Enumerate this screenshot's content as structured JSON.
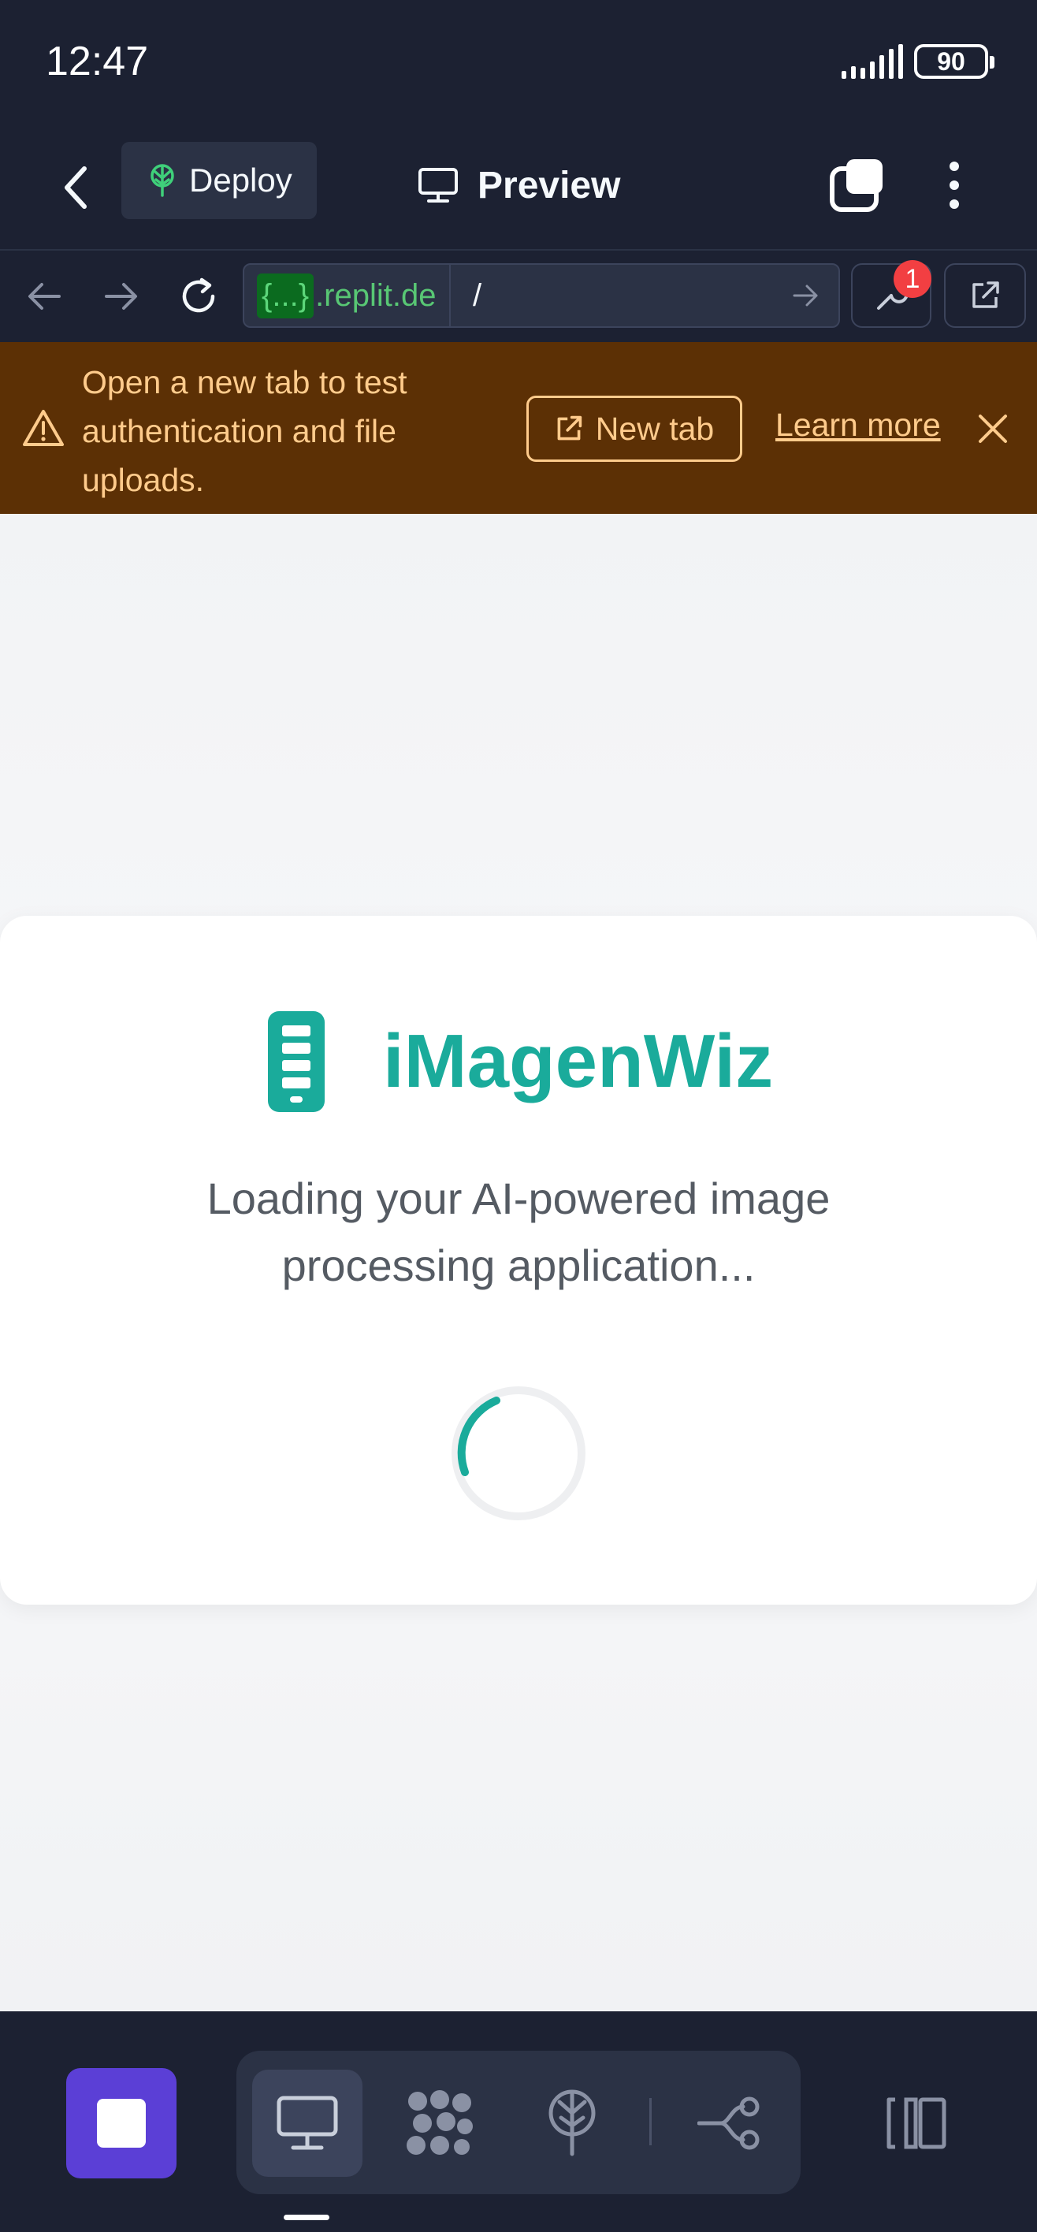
{
  "status_bar": {
    "time": "12:47",
    "battery": "90"
  },
  "header": {
    "deploy_label": "Deploy",
    "title": "Preview"
  },
  "url_bar": {
    "host_chip": "{...}",
    "host": ".replit.de",
    "path": "/",
    "devtools_badge": "1"
  },
  "banner": {
    "message": "Open a new tab to test authentication and file uploads.",
    "new_tab_label": "New tab",
    "learn_more_label": "Learn more"
  },
  "app": {
    "name": "iMagenWiz",
    "loading_text": "Loading your AI-powered image processing application..."
  },
  "bottom_bar": {
    "tabs": [
      "preview",
      "packages",
      "deployments",
      "git"
    ]
  },
  "colors": {
    "background": "#1c2132",
    "surface": "#2b3245",
    "banner_bg": "#5c3005",
    "banner_text": "#ffcb8c",
    "brand_teal": "#1aab9b",
    "stop_button": "#5b3fd6",
    "badge_red": "#f23f42"
  },
  "icons": {
    "back": "chevron-left-icon",
    "deploy": "deploy-tree-icon",
    "preview": "monitor-icon",
    "layers": "layers-icon",
    "more": "more-vertical-icon",
    "nav_back": "arrow-left-icon",
    "nav_forward": "arrow-right-icon",
    "reload": "reload-icon",
    "devtools": "wrench-icon",
    "open_external": "external-link-icon",
    "warning": "warning-icon",
    "close": "close-icon",
    "logo": "phone-logo-icon"
  }
}
